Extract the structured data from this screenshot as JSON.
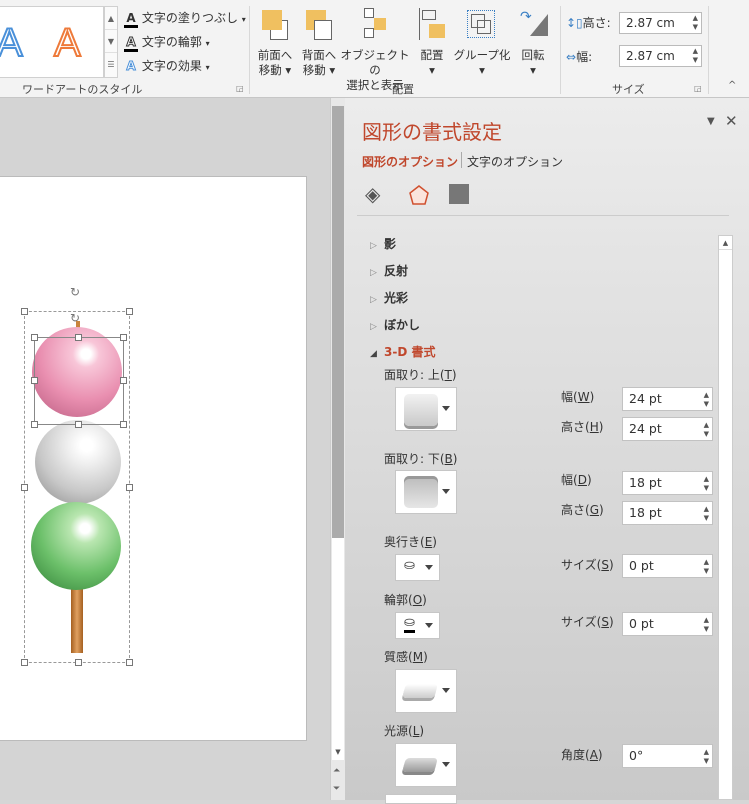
{
  "ribbon": {
    "wordart_group": {
      "label": "ワードアートのスタイル",
      "gallery_glyph": "A",
      "commands": [
        {
          "label": "文字の塗りつぶし",
          "icon": "text-fill-icon",
          "glyph": "A"
        },
        {
          "label": "文字の輪郭",
          "icon": "text-outline-icon",
          "glyph": "A"
        },
        {
          "label": "文字の効果",
          "icon": "text-effects-icon",
          "glyph": "A"
        }
      ]
    },
    "arrange_group": {
      "label": "配置",
      "buttons": [
        {
          "line1": "前面へ",
          "line2": "移動",
          "icon": "bring-forward-icon"
        },
        {
          "line1": "背面へ",
          "line2": "移動",
          "icon": "send-backward-icon"
        },
        {
          "line1": "オブジェクトの",
          "line2": "選択と表示",
          "icon": "selection-pane-icon"
        },
        {
          "line1": "配置",
          "line2": "",
          "icon": "align-icon"
        },
        {
          "line1": "グループ化",
          "line2": "",
          "icon": "group-icon"
        },
        {
          "line1": "回転",
          "line2": "",
          "icon": "rotate-icon"
        }
      ]
    },
    "size_group": {
      "label": "サイズ",
      "height_label": "高さ:",
      "height_value": "2.87 cm",
      "width_label": "幅:",
      "width_value": "2.87 cm"
    }
  },
  "pane": {
    "title": "図形の書式設定",
    "tabs": [
      "図形のオプション",
      "文字のオプション"
    ],
    "sections": [
      "影",
      "反射",
      "光彩",
      "ぼかし"
    ],
    "expanded_section": "3-D 書式",
    "bevel_top": {
      "label": "面取り: 上",
      "key": "T",
      "width_label": "幅",
      "width_key": "W",
      "width_value": "24 pt",
      "height_label": "高さ",
      "height_key": "H",
      "height_value": "24 pt"
    },
    "bevel_bottom": {
      "label": "面取り: 下",
      "key": "B",
      "width_label": "幅",
      "width_key": "D",
      "width_value": "18 pt",
      "height_label": "高さ",
      "height_key": "G",
      "height_value": "18 pt"
    },
    "depth": {
      "label": "奥行き",
      "key": "E",
      "size_label": "サイズ",
      "size_key": "S",
      "size_value": "0 pt"
    },
    "contour": {
      "label": "輪郭",
      "key": "O",
      "size_label": "サイズ",
      "size_key": "S",
      "size_value": "0 pt"
    },
    "material": {
      "label": "質感",
      "key": "M"
    },
    "lighting": {
      "label": "光源",
      "key": "L",
      "angle_label": "角度",
      "angle_key": "A",
      "angle_value": "0°"
    }
  },
  "colors": {
    "accent": "#c0472c",
    "pink": "#e98fb0",
    "white": "#dddddd",
    "green": "#5fb85f",
    "stick": "#c9853e"
  }
}
